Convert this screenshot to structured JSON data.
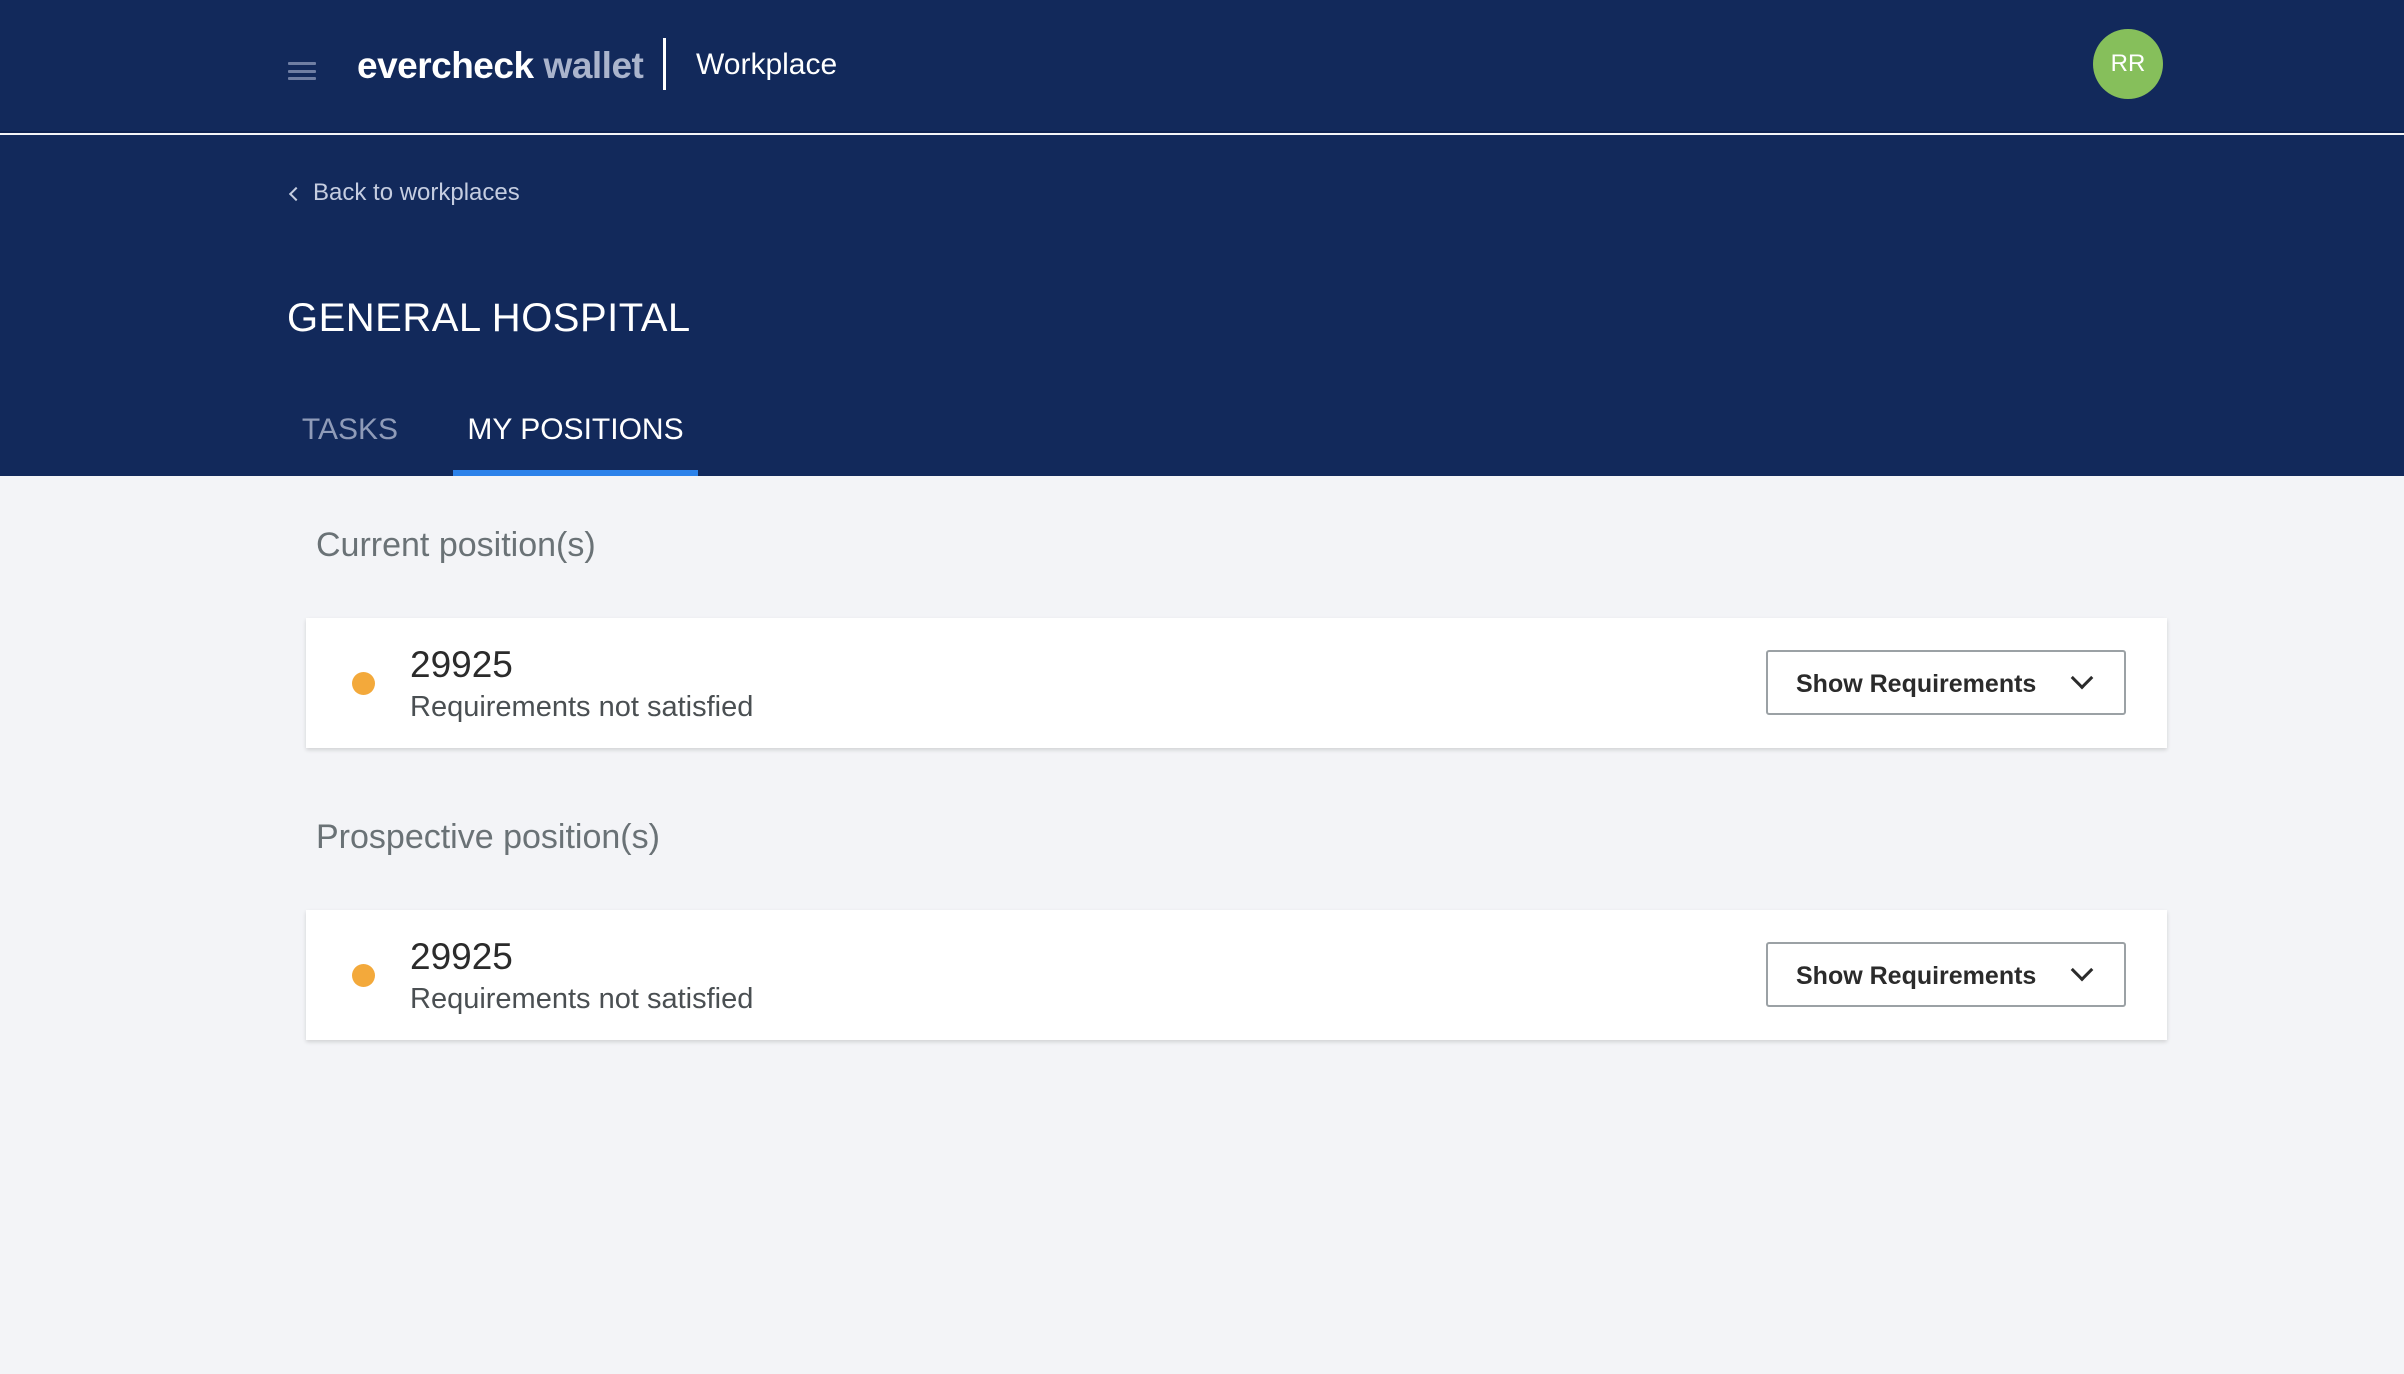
{
  "topbar": {
    "brand_primary": "evercheck",
    "brand_secondary": "wallet",
    "section": "Workplace",
    "avatar_initials": "RR",
    "avatar_color": "#86bf5b"
  },
  "header": {
    "back_link": "Back to workplaces",
    "title": "GENERAL HOSPITAL",
    "tabs": [
      {
        "label": "TASKS",
        "active": false
      },
      {
        "label": "MY POSITIONS",
        "active": true
      }
    ]
  },
  "sections": {
    "current": {
      "heading": "Current position(s)",
      "positions": [
        {
          "id": "29925",
          "status": "Requirements not satisfied",
          "status_color": "#f3a93b",
          "button": "Show Requirements"
        }
      ]
    },
    "prospective": {
      "heading": "Prospective position(s)",
      "positions": [
        {
          "id": "29925",
          "status": "Requirements not satisfied",
          "status_color": "#f3a93b",
          "button": "Show Requirements"
        }
      ]
    }
  },
  "colors": {
    "navy": "#12295b",
    "accent": "#2c82ea",
    "page_bg": "#f3f4f7"
  }
}
